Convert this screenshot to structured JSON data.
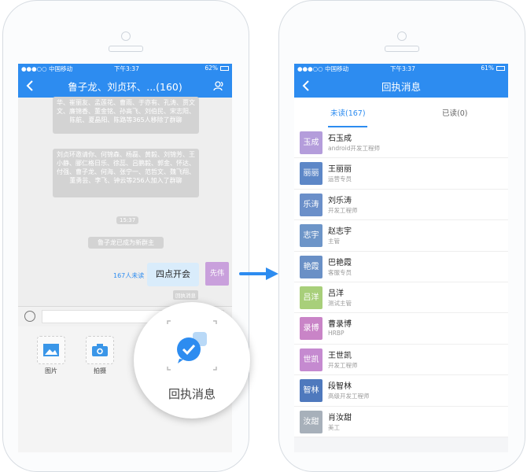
{
  "status": {
    "carrier": "●●●○○ 中国移动",
    "time": "下午3:37",
    "battery_left": "62%",
    "battery_right": "61%"
  },
  "chat": {
    "title": "鲁子龙、刘贞环、...(160)",
    "sys1": "华、崔丽友、孟莲花、曹雨、于亦有、孔涛、贾文文、廉锦香、董金铭、孙高飞、刘伯民、宋志阳、陈航、夏晶阳、陈路等365人移除了群聊",
    "sys2": "刘贞环邀请你、何锦森、杨磊、黄毅、刘锦芳、王小静、郦仁格日乐、徐蕊、吕鹏毅、郭金、怀达、付强、曹子龙、何海、张宁一、范哲文、魏飞翔、董勇芸、李飞、钟云等256人加入了群聊",
    "time": "15:37",
    "sys3": "鲁子龙已成为新群主",
    "unread": "167人未读",
    "message": "四点开会",
    "avatar": "先伟",
    "receipt_tag": "回执消息",
    "tools": [
      {
        "label": "图片"
      },
      {
        "label": "拍摄"
      }
    ]
  },
  "magnifier": {
    "label": "回执消息"
  },
  "receipt": {
    "title": "回执消息",
    "tab_unread": "未读(167)",
    "tab_read": "已读(0)",
    "divider": "|",
    "people": [
      {
        "avatar": "玉成",
        "name": "石玉成",
        "role": "android开发工程师",
        "color": "#b49ddb"
      },
      {
        "avatar": "丽丽",
        "name": "王丽丽",
        "role": "运营专员",
        "color": "#5d87c7"
      },
      {
        "avatar": "乐涛",
        "name": "刘乐涛",
        "role": "开发工程师",
        "color": "#6b8fc9"
      },
      {
        "avatar": "志宇",
        "name": "赵志宇",
        "role": "主管",
        "color": "#6d95c8"
      },
      {
        "avatar": "艳霞",
        "name": "巴艳霞",
        "role": "客服专员",
        "color": "#6a90c6"
      },
      {
        "avatar": "吕洋",
        "name": "吕洋",
        "role": "测试主管",
        "color": "#a8cf7a"
      },
      {
        "avatar": "录博",
        "name": "曹录博",
        "role": "HRBP",
        "color": "#c984c7"
      },
      {
        "avatar": "世凯",
        "name": "王世凯",
        "role": "开发工程师",
        "color": "#c58ad0"
      },
      {
        "avatar": "智林",
        "name": "段智林",
        "role": "高级开发工程师",
        "color": "#4f79bd"
      },
      {
        "avatar": "汝甜",
        "name": "肖汝甜",
        "role": "美工",
        "color": "#a7b0ba"
      }
    ]
  }
}
